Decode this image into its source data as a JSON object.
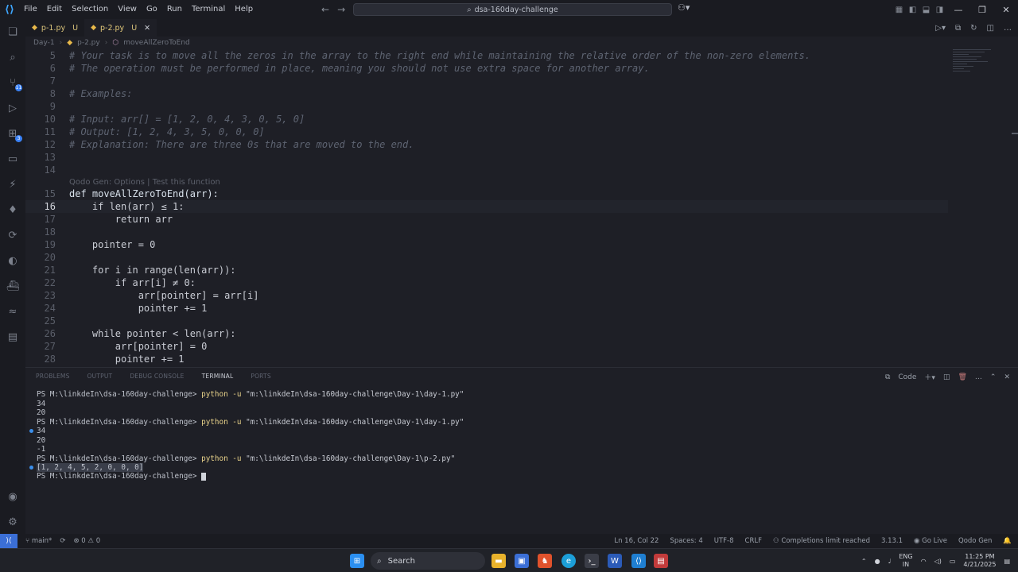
{
  "window": {
    "menu": [
      "File",
      "Edit",
      "Selection",
      "View",
      "Go",
      "Run",
      "Terminal",
      "Help"
    ],
    "search_text": "dsa-160day-challenge"
  },
  "tabs": [
    {
      "label": "p-1.py",
      "status": "U"
    },
    {
      "label": "p-2.py",
      "status": "U"
    }
  ],
  "breadcrumb": [
    "Day-1",
    "p-2.py",
    "moveAllZeroToEnd"
  ],
  "editor": {
    "codelens": "Qodo Gen: Options | Test this function",
    "lines": [
      {
        "n": "5",
        "text": "# Your task is to move all the zeros in the array to the right end while maintaining the relative order of the non-zero elements."
      },
      {
        "n": "6",
        "text": "# The operation must be performed in place, meaning you should not use extra space for another array."
      },
      {
        "n": "7",
        "text": ""
      },
      {
        "n": "8",
        "text": "# Examples:"
      },
      {
        "n": "9",
        "text": ""
      },
      {
        "n": "10",
        "text": "# Input: arr[] = [1, 2, 0, 4, 3, 0, 5, 0]"
      },
      {
        "n": "11",
        "text": "# Output: [1, 2, 4, 3, 5, 0, 0, 0]"
      },
      {
        "n": "12",
        "text": "# Explanation: There are three 0s that are moved to the end."
      },
      {
        "n": "13",
        "text": ""
      },
      {
        "n": "14",
        "text": ""
      },
      {
        "n": "15",
        "text": "def moveAllZeroToEnd(arr):"
      },
      {
        "n": "16",
        "text": "    if len(arr) ≤ 1:"
      },
      {
        "n": "17",
        "text": "        return arr"
      },
      {
        "n": "18",
        "text": ""
      },
      {
        "n": "19",
        "text": "    pointer = 0"
      },
      {
        "n": "20",
        "text": ""
      },
      {
        "n": "21",
        "text": "    for i in range(len(arr)):"
      },
      {
        "n": "22",
        "text": "        if arr[i] ≠ 0:"
      },
      {
        "n": "23",
        "text": "            arr[pointer] = arr[i]"
      },
      {
        "n": "24",
        "text": "            pointer += 1"
      },
      {
        "n": "25",
        "text": ""
      },
      {
        "n": "26",
        "text": "    while pointer < len(arr):"
      },
      {
        "n": "27",
        "text": "        arr[pointer] = 0"
      },
      {
        "n": "28",
        "text": "        pointer += 1"
      }
    ]
  },
  "panel": {
    "tabs": [
      "PROBLEMS",
      "OUTPUT",
      "DEBUG CONSOLE",
      "TERMINAL",
      "PORTS"
    ],
    "active_tab": "TERMINAL",
    "code_label": "Code",
    "terminal": [
      {
        "prompt": "PS M:\\linkdeIn\\dsa-160day-challenge> ",
        "cmd": "python -u ",
        "arg": "\"m:\\linkdeIn\\dsa-160day-challenge\\Day-1\\day-1.py\""
      },
      {
        "out": "34"
      },
      {
        "out": "20"
      },
      {
        "prompt": "PS M:\\linkdeIn\\dsa-160day-challenge> ",
        "cmd": "python -u ",
        "arg": "\"m:\\linkdeIn\\dsa-160day-challenge\\Day-1\\day-1.py\""
      },
      {
        "out": "34"
      },
      {
        "out": "20"
      },
      {
        "out": "-1"
      },
      {
        "prompt": "PS M:\\linkdeIn\\dsa-160day-challenge> ",
        "cmd": "python -u ",
        "arg": "\"m:\\linkdeIn\\dsa-160day-challenge\\Day-1\\p-2.py\""
      },
      {
        "out": "[1, 2, 4, 5, 2, 0, 0, 0]"
      },
      {
        "prompt": "PS M:\\linkdeIn\\dsa-160day-challenge> "
      }
    ]
  },
  "status": {
    "branch": "main*",
    "errors": "0",
    "warnings": "0",
    "position": "Ln 16, Col 22",
    "spaces": "Spaces: 4",
    "encoding": "UTF-8",
    "eol": "CRLF",
    "completions": "Completions limit reached",
    "version": "3.13.1",
    "golive": "Go Live",
    "qodo": "Qodo Gen"
  },
  "taskbar": {
    "search": "Search",
    "lang": "ENG",
    "region": "IN",
    "time": "11:25 PM",
    "date": "4/21/2025"
  }
}
